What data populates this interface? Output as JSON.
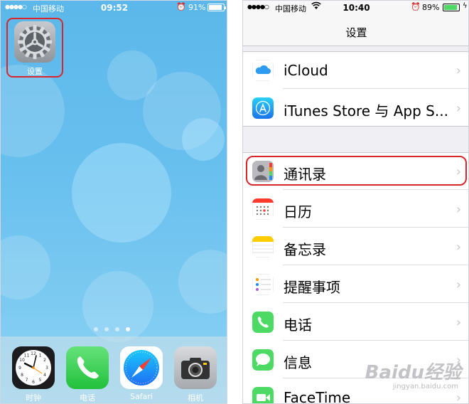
{
  "home": {
    "status": {
      "signal": "●●●●○",
      "carrier": "中国移动",
      "time": "09:52",
      "alarm": "⏰",
      "battery": "91%",
      "battery_level": 0.91
    },
    "settings_app": {
      "label": "设置"
    },
    "page_dots": 4,
    "dock": [
      {
        "label": "时钟",
        "icon": "clock-icon"
      },
      {
        "label": "电话",
        "icon": "phone-icon"
      },
      {
        "label": "Safari",
        "icon": "safari-icon"
      },
      {
        "label": "相机",
        "icon": "camera-icon"
      }
    ]
  },
  "settings": {
    "status": {
      "signal": "●●●●○",
      "carrier": "中国移动",
      "wifi": "wifi-icon",
      "time": "10:40",
      "alarm": "⏰",
      "battery": "89%",
      "battery_level": 0.89
    },
    "title": "设置",
    "groups": [
      {
        "rows": [
          {
            "label": "iCloud",
            "icon": "icloud-icon"
          },
          {
            "label": "iTunes Store 与 App S...",
            "icon": "app-store-icon"
          }
        ]
      },
      {
        "rows": [
          {
            "label": "通讯录",
            "icon": "contacts-icon"
          },
          {
            "label": "日历",
            "icon": "calendar-icon"
          },
          {
            "label": "备忘录",
            "icon": "notes-icon"
          },
          {
            "label": "提醒事项",
            "icon": "reminders-icon"
          },
          {
            "label": "电话",
            "icon": "phone-icon"
          },
          {
            "label": "信息",
            "icon": "messages-icon"
          },
          {
            "label": "FaceTime",
            "icon": "facetime-icon"
          }
        ]
      }
    ],
    "chevron": "›"
  },
  "watermark": {
    "brand": "Baidu经验",
    "url": "jingyan.baidu.com"
  },
  "colors": {
    "highlight": "#d9262c",
    "ios_green": "#4cd964",
    "ios_blue": "#1d8ef3"
  }
}
